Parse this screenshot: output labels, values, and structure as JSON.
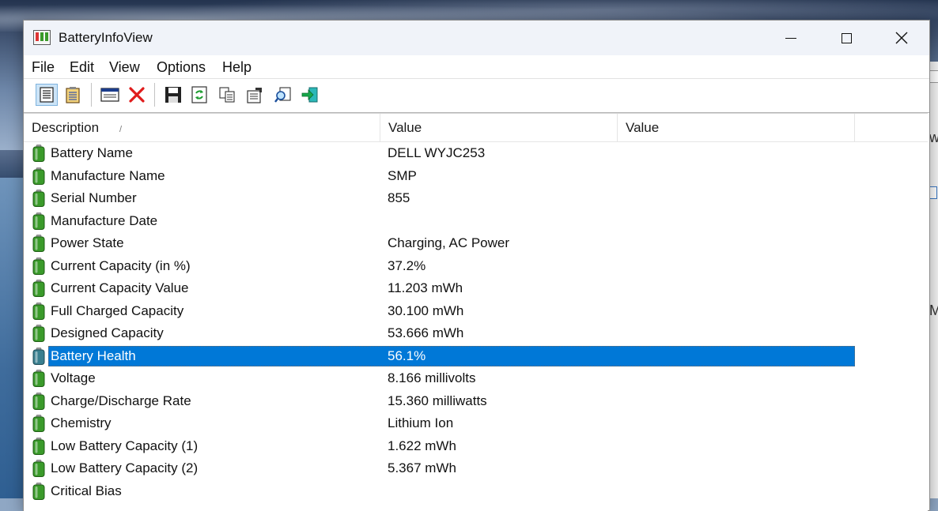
{
  "window": {
    "title": "BatteryInfoView",
    "minimize_label": "Minimize",
    "maximize_label": "Maximize",
    "close_label": "Close"
  },
  "menu": [
    "File",
    "Edit",
    "View",
    "Options",
    "Help"
  ],
  "toolbar": {
    "buttons": [
      {
        "name": "battery-information-icon",
        "pressed": true
      },
      {
        "name": "battery-log-icon",
        "pressed": false
      },
      {
        "name": "html-report-icon",
        "pressed": false
      },
      {
        "name": "delete-icon",
        "pressed": false
      },
      {
        "name": "save-icon",
        "pressed": false
      },
      {
        "name": "refresh-icon",
        "pressed": false
      },
      {
        "name": "copy-icon",
        "pressed": false
      },
      {
        "name": "properties-icon",
        "pressed": false
      },
      {
        "name": "find-icon",
        "pressed": false
      },
      {
        "name": "exit-icon",
        "pressed": false
      }
    ]
  },
  "columns": [
    "Description",
    "Value",
    "Value"
  ],
  "sort_indicator": "/",
  "rows": [
    {
      "description": "Battery Name",
      "value": "DELL WYJC253"
    },
    {
      "description": "Manufacture Name",
      "value": "SMP"
    },
    {
      "description": "Serial Number",
      "value": "855"
    },
    {
      "description": "Manufacture Date",
      "value": ""
    },
    {
      "description": "Power State",
      "value": "Charging, AC Power"
    },
    {
      "description": "Current Capacity (in %)",
      "value": "37.2%"
    },
    {
      "description": "Current Capacity Value",
      "value": "11.203 mWh"
    },
    {
      "description": "Full Charged Capacity",
      "value": "30.100 mWh"
    },
    {
      "description": "Designed Capacity",
      "value": "53.666 mWh"
    },
    {
      "description": "Battery Health",
      "value": "56.1%"
    },
    {
      "description": "Voltage",
      "value": "8.166 millivolts"
    },
    {
      "description": "Charge/Discharge Rate",
      "value": "15.360 milliwatts"
    },
    {
      "description": "Chemistry",
      "value": "Lithium Ion"
    },
    {
      "description": "Low Battery Capacity (1)",
      "value": "1.622 mWh"
    },
    {
      "description": "Low Battery Capacity (2)",
      "value": "5.367 mWh"
    },
    {
      "description": "Critical Bias",
      "value": ""
    }
  ],
  "selected_row": "Battery Health",
  "background_window": {
    "glyphs": [
      "w",
      "M"
    ]
  },
  "colors": {
    "selection": "#0078d7",
    "battery_green": "#3a9a2a",
    "titlebar": "#f0f3f9"
  }
}
